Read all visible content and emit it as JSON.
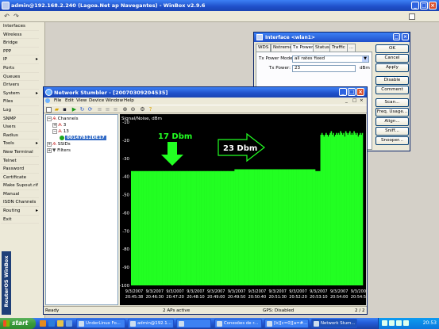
{
  "winbox": {
    "title": "admin@192.168.2.240 (Lagoa.Net ap Navegantes) - WinBox v2.9.6",
    "side_brand": "RouterOS WinBox"
  },
  "sidebar": {
    "items": [
      {
        "label": "Interfaces",
        "submenu": false
      },
      {
        "label": "Wireless",
        "submenu": false
      },
      {
        "label": "Bridge",
        "submenu": false
      },
      {
        "label": "PPP",
        "submenu": false
      },
      {
        "label": "IP",
        "submenu": true
      },
      {
        "label": "Ports",
        "submenu": false
      },
      {
        "label": "Queues",
        "submenu": false
      },
      {
        "label": "Drivers",
        "submenu": false
      },
      {
        "label": "System",
        "submenu": true
      },
      {
        "label": "Files",
        "submenu": false
      },
      {
        "label": "Log",
        "submenu": false
      },
      {
        "label": "SNMP",
        "submenu": false
      },
      {
        "label": "Users",
        "submenu": false
      },
      {
        "label": "Radius",
        "submenu": false
      },
      {
        "label": "Tools",
        "submenu": true
      },
      {
        "label": "New Terminal",
        "submenu": false
      },
      {
        "label": "Telnet",
        "submenu": false
      },
      {
        "label": "Password",
        "submenu": false
      },
      {
        "label": "Certificate",
        "submenu": false
      },
      {
        "label": "Make Supout.rif",
        "submenu": false
      },
      {
        "label": "Manual",
        "submenu": false
      },
      {
        "label": "ISDN Channels",
        "submenu": false
      },
      {
        "label": "Routing",
        "submenu": true
      },
      {
        "label": "Exit",
        "submenu": false
      }
    ]
  },
  "interface_dialog": {
    "title": "Interface <wlan1>",
    "tabs": [
      "WDS",
      "Nstreme",
      "Tx Power",
      "Status",
      "Traffic",
      "..."
    ],
    "active_tab": "Tx Power",
    "tx_power_mode_label": "Tx Power Mode:",
    "tx_power_mode_value": "all rates fixed",
    "tx_power_label": "Tx Power:",
    "tx_power_value": "23",
    "tx_power_unit": "dBm",
    "buttons": [
      "OK",
      "Cancel",
      "Apply",
      "Disable",
      "Comment",
      "Scan...",
      "Freq. Usage...",
      "Align...",
      "Sniff...",
      "Snooper..."
    ]
  },
  "stumbler": {
    "title": "Network Stumbler - [20070309204535]",
    "menu": [
      "File",
      "Edit",
      "View",
      "Device",
      "Window",
      "Help"
    ],
    "tree": {
      "channels": "Channels",
      "ch3": "3",
      "ch13": "13",
      "ap": "00147B12DE17",
      "ssids": "SSIDs",
      "filters": "Filters"
    },
    "status_left": "Ready",
    "status_mid": "2 APs active",
    "status_gps": "GPS: Disabled",
    "status_page": "2 / 2"
  },
  "chart_data": {
    "type": "bar",
    "ylabel": "Signal/Noise, dBm",
    "ylim": [
      -100,
      -10
    ],
    "yticks": [
      -10,
      -20,
      -30,
      -40,
      -50,
      -60,
      -70,
      -80,
      -90,
      -100
    ],
    "xticks": [
      "9/3/2007 20:45:38",
      "9/3/2007 20:46:30",
      "9/3/2007 20:47:20",
      "9/3/2007 20:48:10",
      "9/3/2007 20:49:00",
      "9/3/2007 20:49:50",
      "9/3/2007 20:50:40",
      "9/3/2007 20:51:30",
      "9/3/2007 20:52:20",
      "9/3/2007 20:53:10",
      "9/3/2007 20:54:00",
      "9/3/2007 20:54:50"
    ],
    "series": [
      {
        "values": [
          -37,
          -37,
          -37,
          -37,
          -37,
          -37,
          -37,
          -37,
          -37,
          -37,
          -37,
          -37,
          -37,
          -37,
          -37,
          -37,
          -37,
          -37,
          -37,
          -37,
          -37,
          -37,
          -37,
          -37,
          -37,
          -37,
          -37,
          -37,
          -37,
          -37,
          -37,
          -37,
          -37,
          -37,
          -37,
          -37,
          -37,
          -37,
          -37,
          -37,
          -37,
          -37,
          -37,
          -37,
          -37,
          -37,
          -37,
          -37,
          -37,
          -37,
          -37,
          -37,
          -37,
          -37,
          -37,
          -37,
          -37,
          -37,
          -37,
          -37,
          -37,
          -37,
          -37,
          -37,
          -37,
          -37,
          -37,
          -37,
          -37,
          -37,
          -37,
          -37,
          -37,
          -37,
          -37,
          -37,
          -37,
          -37,
          -37,
          -37,
          -37,
          -37,
          -37,
          -37,
          -37,
          -37,
          -37,
          -37,
          -37,
          -37,
          -37,
          -37,
          -37,
          -37,
          -37,
          -37,
          -37,
          -37,
          -37,
          -37,
          -36,
          -36,
          -36,
          -36,
          -36,
          -36,
          -36,
          -36,
          -36,
          -36,
          -36,
          -36,
          -36,
          -36,
          -36,
          -36,
          -36,
          -36,
          -36,
          -36,
          -36,
          -36,
          -36,
          -36,
          -36,
          -36,
          -36,
          -36,
          -36,
          -36,
          -36,
          -36,
          -36,
          -36,
          -36,
          -36,
          -36,
          -36,
          -36,
          -36,
          -36,
          -36,
          -36,
          -36,
          -36,
          -36,
          -36,
          -36,
          -36,
          -36,
          -36,
          -36,
          -36,
          -36,
          -36,
          -36,
          -36,
          -36,
          -36,
          -36,
          -36,
          -36,
          -36,
          -36,
          -36,
          -36,
          -36,
          -36,
          -36,
          -36,
          -36,
          -36,
          -36,
          -36,
          -36,
          -36,
          -36,
          -36,
          -37,
          -37,
          -37,
          -37,
          -37,
          -17,
          -16,
          -17,
          -18,
          -17,
          -16,
          -17,
          -18,
          -17,
          -16,
          -15,
          -17,
          -16,
          -18,
          -17,
          -16,
          -17,
          -16,
          -17,
          -15,
          -16,
          -17,
          -16,
          -18,
          -15,
          -16,
          -17,
          -16,
          -15,
          -17,
          -16,
          -17,
          -15,
          -16,
          -17,
          -16,
          -18,
          -17,
          -16,
          -17,
          -16
        ]
      }
    ],
    "annotations": [
      "17 Dbm",
      "23 Dbm"
    ],
    "colors": {
      "bars": "#22ff22",
      "background": "#000000",
      "annotation": "#22ff22"
    }
  },
  "taskbar": {
    "start_label": "start",
    "tasks": [
      "UnderLinux Fo...",
      "admin@192.1...",
      "",
      "Conexões de r...",
      "[b][c=0][a=#...",
      "Network Stum..."
    ],
    "active_task": 5,
    "clock": "20:53"
  }
}
